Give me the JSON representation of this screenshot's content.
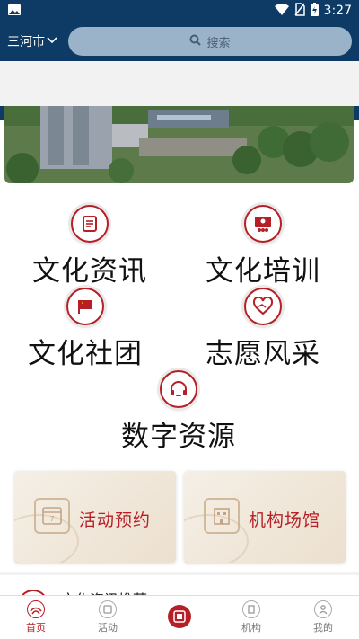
{
  "status_bar": {
    "time": "3:27",
    "icons": [
      "image-icon",
      "wifi-icon",
      "no-sim-icon",
      "battery-icon"
    ]
  },
  "header": {
    "city": "三河市",
    "search_placeholder": "搜索"
  },
  "categories": [
    {
      "label": "文化资讯",
      "icon": "news-icon"
    },
    {
      "label": "文化培训",
      "icon": "training-icon"
    },
    {
      "label": "文化社团",
      "icon": "flag-icon"
    },
    {
      "label": "志愿风采",
      "icon": "volunteer-heart-icon"
    },
    {
      "label": "数字资源",
      "icon": "headset-icon"
    }
  ],
  "cards": [
    {
      "title": "活动预约",
      "icon": "calendar-icon"
    },
    {
      "title": "机构场馆",
      "icon": "building-icon"
    }
  ],
  "news_section": {
    "title": "文化资讯推荐"
  },
  "bottom_nav": [
    {
      "label": "首页",
      "icon": "home-icon",
      "active": true
    },
    {
      "label": "活动",
      "icon": "activity-icon",
      "active": false
    },
    {
      "label": "",
      "icon": "center-logo-icon",
      "active": false
    },
    {
      "label": "机构",
      "icon": "institution-icon",
      "active": false
    },
    {
      "label": "我的",
      "icon": "profile-icon",
      "active": false
    }
  ],
  "colors": {
    "brand_navy": "#0e3b66",
    "accent_red": "#b51f25",
    "search_bg": "#9ab3c9"
  }
}
